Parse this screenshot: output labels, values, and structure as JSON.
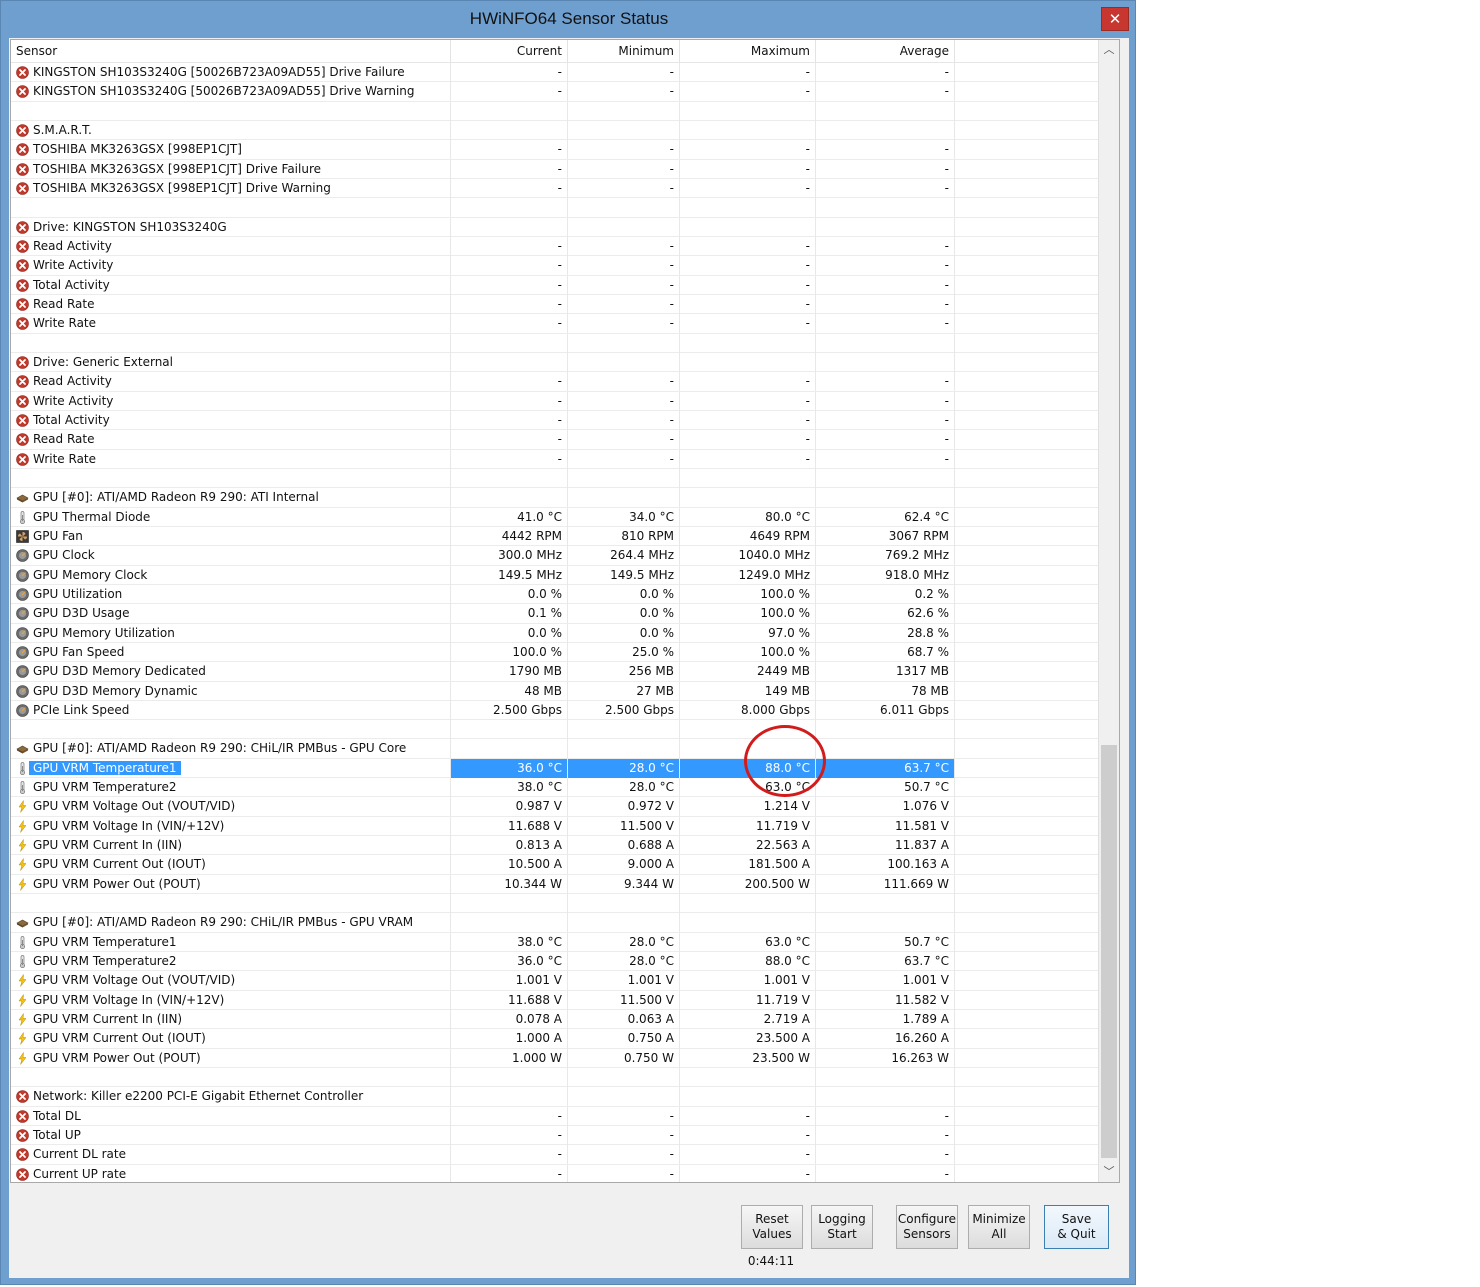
{
  "window": {
    "title": "HWiNFO64 Sensor Status",
    "close_symbol": "✕"
  },
  "columns": [
    "Sensor",
    "Current",
    "Minimum",
    "Maximum",
    "Average"
  ],
  "rows": [
    {
      "icon": "error-icon",
      "name": "KINGSTON SH103S3240G [50026B723A09AD55] Drive Failure",
      "cur": "-",
      "min": "-",
      "max": "-",
      "avg": "-"
    },
    {
      "icon": "error-icon",
      "name": "KINGSTON SH103S3240G [50026B723A09AD55] Drive Warning",
      "cur": "-",
      "min": "-",
      "max": "-",
      "avg": "-"
    },
    {
      "blank": true
    },
    {
      "icon": "error-icon",
      "name": "S.M.A.R.T.",
      "group": true
    },
    {
      "icon": "error-icon",
      "name": "TOSHIBA MK3263GSX [998EP1CJT]",
      "cur": "-",
      "min": "-",
      "max": "-",
      "avg": "-"
    },
    {
      "icon": "error-icon",
      "name": "TOSHIBA MK3263GSX [998EP1CJT] Drive Failure",
      "cur": "-",
      "min": "-",
      "max": "-",
      "avg": "-"
    },
    {
      "icon": "error-icon",
      "name": "TOSHIBA MK3263GSX [998EP1CJT] Drive Warning",
      "cur": "-",
      "min": "-",
      "max": "-",
      "avg": "-"
    },
    {
      "blank": true
    },
    {
      "icon": "error-icon",
      "name": "Drive: KINGSTON SH103S3240G",
      "group": true
    },
    {
      "icon": "error-icon",
      "name": "Read Activity",
      "cur": "-",
      "min": "-",
      "max": "-",
      "avg": "-"
    },
    {
      "icon": "error-icon",
      "name": "Write Activity",
      "cur": "-",
      "min": "-",
      "max": "-",
      "avg": "-"
    },
    {
      "icon": "error-icon",
      "name": "Total Activity",
      "cur": "-",
      "min": "-",
      "max": "-",
      "avg": "-"
    },
    {
      "icon": "error-icon",
      "name": "Read Rate",
      "cur": "-",
      "min": "-",
      "max": "-",
      "avg": "-"
    },
    {
      "icon": "error-icon",
      "name": "Write Rate",
      "cur": "-",
      "min": "-",
      "max": "-",
      "avg": "-"
    },
    {
      "blank": true
    },
    {
      "icon": "error-icon",
      "name": "Drive: Generic External",
      "group": true
    },
    {
      "icon": "error-icon",
      "name": "Read Activity",
      "cur": "-",
      "min": "-",
      "max": "-",
      "avg": "-"
    },
    {
      "icon": "error-icon",
      "name": "Write Activity",
      "cur": "-",
      "min": "-",
      "max": "-",
      "avg": "-"
    },
    {
      "icon": "error-icon",
      "name": "Total Activity",
      "cur": "-",
      "min": "-",
      "max": "-",
      "avg": "-"
    },
    {
      "icon": "error-icon",
      "name": "Read Rate",
      "cur": "-",
      "min": "-",
      "max": "-",
      "avg": "-"
    },
    {
      "icon": "error-icon",
      "name": "Write Rate",
      "cur": "-",
      "min": "-",
      "max": "-",
      "avg": "-"
    },
    {
      "blank": true
    },
    {
      "icon": "gpu-icon",
      "name": "GPU [#0]: ATI/AMD Radeon R9 290: ATI Internal",
      "group": true
    },
    {
      "icon": "thermometer-icon",
      "name": "GPU Thermal Diode",
      "cur": "41.0 °C",
      "min": "34.0 °C",
      "max": "80.0 °C",
      "avg": "62.4 °C"
    },
    {
      "icon": "fan-icon",
      "name": "GPU Fan",
      "cur": "4442 RPM",
      "min": "810 RPM",
      "max": "4649 RPM",
      "avg": "3067 RPM"
    },
    {
      "icon": "gauge-icon",
      "name": "GPU Clock",
      "cur": "300.0 MHz",
      "min": "264.4 MHz",
      "max": "1040.0 MHz",
      "avg": "769.2 MHz"
    },
    {
      "icon": "gauge-icon",
      "name": "GPU Memory Clock",
      "cur": "149.5 MHz",
      "min": "149.5 MHz",
      "max": "1249.0 MHz",
      "avg": "918.0 MHz"
    },
    {
      "icon": "gauge-icon",
      "name": "GPU Utilization",
      "cur": "0.0 %",
      "min": "0.0 %",
      "max": "100.0 %",
      "avg": "0.2 %"
    },
    {
      "icon": "gauge-icon",
      "name": "GPU D3D Usage",
      "cur": "0.1 %",
      "min": "0.0 %",
      "max": "100.0 %",
      "avg": "62.6 %"
    },
    {
      "icon": "gauge-icon",
      "name": "GPU Memory Utilization",
      "cur": "0.0 %",
      "min": "0.0 %",
      "max": "97.0 %",
      "avg": "28.8 %"
    },
    {
      "icon": "gauge-icon",
      "name": "GPU Fan Speed",
      "cur": "100.0 %",
      "min": "25.0 %",
      "max": "100.0 %",
      "avg": "68.7 %"
    },
    {
      "icon": "gauge-icon",
      "name": "GPU D3D Memory Dedicated",
      "cur": "1790 MB",
      "min": "256 MB",
      "max": "2449 MB",
      "avg": "1317 MB"
    },
    {
      "icon": "gauge-icon",
      "name": "GPU D3D Memory Dynamic",
      "cur": "48 MB",
      "min": "27 MB",
      "max": "149 MB",
      "avg": "78 MB"
    },
    {
      "icon": "gauge-icon",
      "name": "PCIe Link Speed",
      "cur": "2.500 Gbps",
      "min": "2.500 Gbps",
      "max": "8.000 Gbps",
      "avg": "6.011 Gbps"
    },
    {
      "blank": true
    },
    {
      "icon": "gpu-icon",
      "name": "GPU [#0]: ATI/AMD Radeon R9 290: CHiL/IR PMBus - GPU Core",
      "group": true
    },
    {
      "icon": "thermometer-icon",
      "name": "GPU VRM Temperature1",
      "cur": "36.0 °C",
      "min": "28.0 °C",
      "max": "88.0 °C",
      "avg": "63.7 °C",
      "selected": true
    },
    {
      "icon": "thermometer-icon",
      "name": "GPU VRM Temperature2",
      "cur": "38.0 °C",
      "min": "28.0 °C",
      "max": "63.0 °C",
      "avg": "50.7 °C"
    },
    {
      "icon": "bolt-icon",
      "name": "GPU VRM Voltage Out (VOUT/VID)",
      "cur": "0.987 V",
      "min": "0.972 V",
      "max": "1.214 V",
      "avg": "1.076 V"
    },
    {
      "icon": "bolt-icon",
      "name": "GPU VRM Voltage In (VIN/+12V)",
      "cur": "11.688 V",
      "min": "11.500 V",
      "max": "11.719 V",
      "avg": "11.581 V"
    },
    {
      "icon": "bolt-icon",
      "name": "GPU VRM Current In (IIN)",
      "cur": "0.813 A",
      "min": "0.688 A",
      "max": "22.563 A",
      "avg": "11.837 A"
    },
    {
      "icon": "bolt-icon",
      "name": "GPU VRM Current Out (IOUT)",
      "cur": "10.500 A",
      "min": "9.000 A",
      "max": "181.500 A",
      "avg": "100.163 A"
    },
    {
      "icon": "bolt-icon",
      "name": "GPU VRM Power Out (POUT)",
      "cur": "10.344 W",
      "min": "9.344 W",
      "max": "200.500 W",
      "avg": "111.669 W"
    },
    {
      "blank": true
    },
    {
      "icon": "gpu-icon",
      "name": "GPU [#0]: ATI/AMD Radeon R9 290: CHiL/IR PMBus - GPU VRAM",
      "group": true
    },
    {
      "icon": "thermometer-icon",
      "name": "GPU VRM Temperature1",
      "cur": "38.0 °C",
      "min": "28.0 °C",
      "max": "63.0 °C",
      "avg": "50.7 °C"
    },
    {
      "icon": "thermometer-icon",
      "name": "GPU VRM Temperature2",
      "cur": "36.0 °C",
      "min": "28.0 °C",
      "max": "88.0 °C",
      "avg": "63.7 °C"
    },
    {
      "icon": "bolt-icon",
      "name": "GPU VRM Voltage Out (VOUT/VID)",
      "cur": "1.001 V",
      "min": "1.001 V",
      "max": "1.001 V",
      "avg": "1.001 V"
    },
    {
      "icon": "bolt-icon",
      "name": "GPU VRM Voltage In (VIN/+12V)",
      "cur": "11.688 V",
      "min": "11.500 V",
      "max": "11.719 V",
      "avg": "11.582 V"
    },
    {
      "icon": "bolt-icon",
      "name": "GPU VRM Current In (IIN)",
      "cur": "0.078 A",
      "min": "0.063 A",
      "max": "2.719 A",
      "avg": "1.789 A"
    },
    {
      "icon": "bolt-icon",
      "name": "GPU VRM Current Out (IOUT)",
      "cur": "1.000 A",
      "min": "0.750 A",
      "max": "23.500 A",
      "avg": "16.260 A"
    },
    {
      "icon": "bolt-icon",
      "name": "GPU VRM Power Out (POUT)",
      "cur": "1.000 W",
      "min": "0.750 W",
      "max": "23.500 W",
      "avg": "16.263 W"
    },
    {
      "blank": true
    },
    {
      "icon": "error-icon",
      "name": "Network: Killer e2200 PCI-E Gigabit Ethernet Controller",
      "group": true
    },
    {
      "icon": "error-icon",
      "name": "Total DL",
      "cur": "-",
      "min": "-",
      "max": "-",
      "avg": "-"
    },
    {
      "icon": "error-icon",
      "name": "Total UP",
      "cur": "-",
      "min": "-",
      "max": "-",
      "avg": "-"
    },
    {
      "icon": "error-icon",
      "name": "Current DL rate",
      "cur": "-",
      "min": "-",
      "max": "-",
      "avg": "-"
    },
    {
      "icon": "error-icon",
      "name": "Current UP rate",
      "cur": "-",
      "min": "-",
      "max": "-",
      "avg": "-"
    }
  ],
  "buttons": {
    "reset": {
      "line1": "Reset",
      "line2": "Values"
    },
    "logging": {
      "line1": "Logging",
      "line2": "Start"
    },
    "configure": {
      "line1": "Configure",
      "line2": "Sensors"
    },
    "minimize": {
      "line1": "Minimize",
      "line2": "All"
    },
    "save": {
      "line1": "Save",
      "line2": "& Quit"
    }
  },
  "timer": "0:44:11",
  "scrollbar": {
    "up_symbol": "︿",
    "down_symbol": "﹀"
  },
  "colors": {
    "selection": "#3399ff",
    "annotation_circle": "#d11c1c",
    "error_icon": "#c0392b",
    "titlebar": "#6f9fcf"
  }
}
